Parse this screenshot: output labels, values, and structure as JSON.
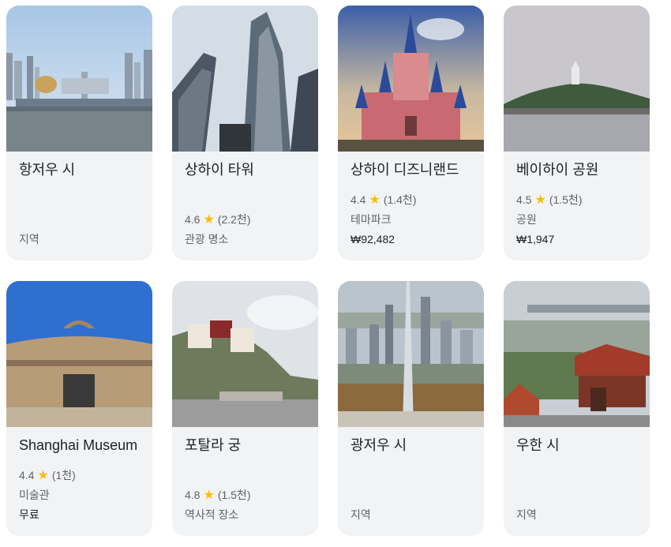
{
  "places": [
    {
      "name": "항저우 시",
      "rating": "",
      "reviews": "",
      "category": "지역",
      "price": "",
      "star_icon": "star-icon"
    },
    {
      "name": "상하이 타워",
      "rating": "4.6",
      "reviews": "(2.2천)",
      "category": "관광 명소",
      "price": ""
    },
    {
      "name": "상하이 디즈니랜드",
      "rating": "4.4",
      "reviews": "(1.4천)",
      "category": "테마파크",
      "price": "₩92,482"
    },
    {
      "name": "베이하이 공원",
      "rating": "4.5",
      "reviews": "(1.5천)",
      "category": "공원",
      "price": "₩1,947"
    },
    {
      "name": "Shanghai Museum",
      "rating": "4.4",
      "reviews": "(1천)",
      "category": "미술관",
      "price": "무료"
    },
    {
      "name": "포탈라 궁",
      "rating": "4.8",
      "reviews": "(1.5천)",
      "category": "역사적 장소",
      "price": ""
    },
    {
      "name": "광저우 시",
      "rating": "",
      "reviews": "",
      "category": "지역",
      "price": ""
    },
    {
      "name": "우한 시",
      "rating": "",
      "reviews": "",
      "category": "지역",
      "price": ""
    }
  ],
  "colors": {
    "card_bg": "#f1f3f4",
    "star": "#fbbc04",
    "secondary_text": "#5f6368"
  }
}
